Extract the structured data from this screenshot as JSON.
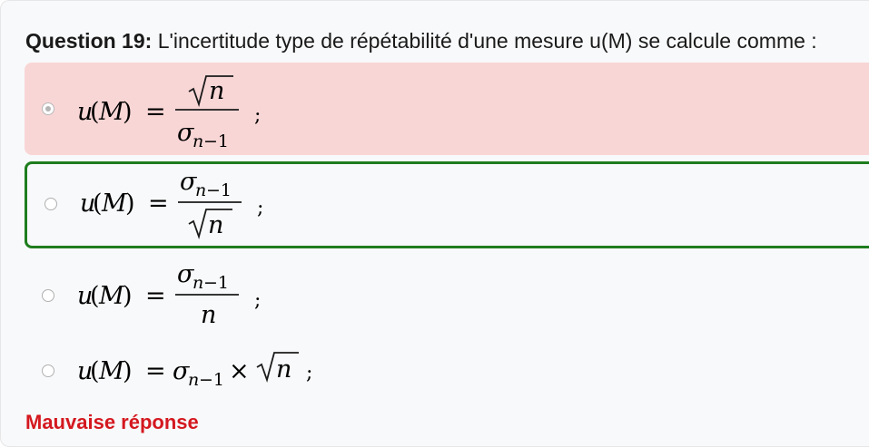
{
  "question": {
    "number_label": "Question 19:",
    "text": "L'incertitude type de répétabilité d'une mesure u(M) se calcule comme :"
  },
  "options": [
    {
      "state": "selected-incorrect",
      "lhs": "u(M)",
      "equals": "=",
      "numerator": "√n",
      "denominator": "σn−1",
      "terminator": ";"
    },
    {
      "state": "correct-answer",
      "lhs": "u(M)",
      "equals": "=",
      "numerator": "σn−1",
      "denominator": "√n",
      "terminator": ";"
    },
    {
      "state": "unselected",
      "lhs": "u(M)",
      "equals": "=",
      "numerator": "σn−1",
      "denominator": "n",
      "terminator": ";"
    },
    {
      "state": "unselected",
      "expression": "u(M) = σn−1 × √n",
      "terminator": ";"
    }
  ],
  "feedback": {
    "text": "Mauvaise réponse",
    "color": "#d4181f"
  },
  "colors": {
    "wrong_background": "#f9d6d6",
    "correct_border": "#1e7d1e"
  }
}
